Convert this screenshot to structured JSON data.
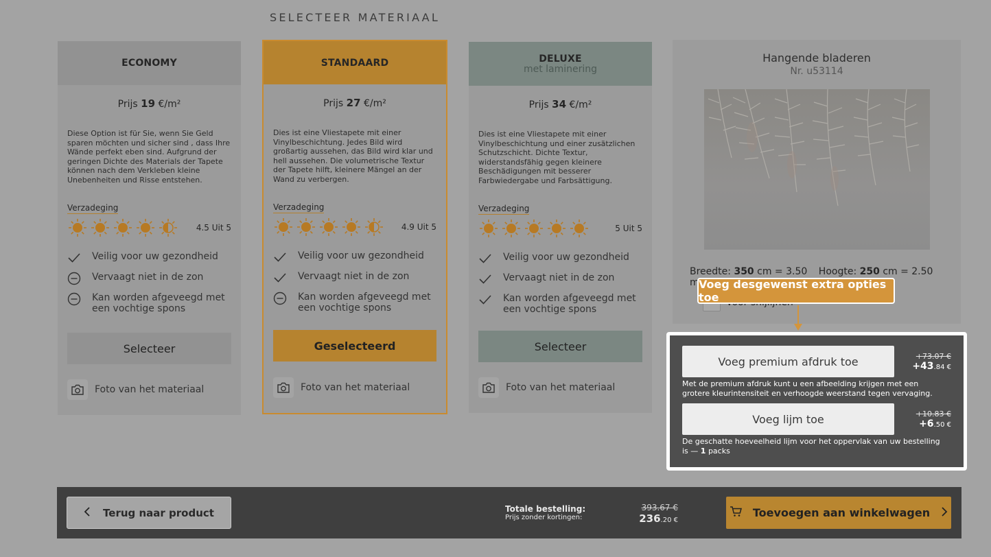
{
  "page": {
    "title": "SELECTEER MATERIAAL"
  },
  "colors": {
    "accent": "#d4953b",
    "selected_accent": "#b98630",
    "deluxe": "#7b8782"
  },
  "materials": [
    {
      "name": "ECONOMY",
      "subtitle": "",
      "price_prefix": "Prijs",
      "price_value": "19",
      "price_unit": "€/m²",
      "description": "Diese Option ist für Sie, wenn Sie Geld sparen möchten und sicher sind , dass Ihre Wände perfekt eben sind. Aufgrund der geringen Dichte des Materials der Tapete können nach dem Verkleben kleine Unebenheiten und Risse entstehen.",
      "density_label": "Verzadeging",
      "rating": 4.5,
      "rating_text": "4.5 Uit 5",
      "features": [
        {
          "icon": "check-icon",
          "text": "Veilig voor uw gezondheid"
        },
        {
          "icon": "minus-circle-icon",
          "text": "Vervaagt niet in de zon"
        },
        {
          "icon": "minus-circle-icon",
          "text": "Kan worden afgeveegd met een vochtige spons"
        }
      ],
      "button_label": "Selecteer",
      "photo_label": "Foto van het materiaal"
    },
    {
      "name": "STANDAARD",
      "subtitle": "",
      "price_prefix": "Prijs",
      "price_value": "27",
      "price_unit": "€/m²",
      "description": "Dies ist eine Vliestapete mit einer Vinylbeschichtung. Jedes Bild wird großartig aussehen, das Bild wird klar und hell aussehen. Die volumetrische Textur der Tapete hilft, kleinere Mängel an der Wand zu verbergen.",
      "density_label": "Verzadeging",
      "rating": 4.9,
      "rating_text": "4.9 Uit 5",
      "features": [
        {
          "icon": "check-icon",
          "text": "Veilig voor uw gezondheid"
        },
        {
          "icon": "check-icon",
          "text": "Vervaagt niet in de zon"
        },
        {
          "icon": "minus-circle-icon",
          "text": "Kan worden afgeveegd met een vochtige spons"
        }
      ],
      "button_label": "Geselecteerd",
      "photo_label": "Foto van het materiaal"
    },
    {
      "name": "DELUXE",
      "subtitle": "met laminering",
      "price_prefix": "Prijs",
      "price_value": "34",
      "price_unit": "€/m²",
      "description": "Dies ist eine Vliestapete mit einer Vinylbeschichtung und einer zusätzlichen Schutzschicht. Dichte Textur, widerstandsfähig gegen kleinere Beschädigungen mit besserer Farbwiedergabe und Farbsättigung.",
      "density_label": "Verzadeging",
      "rating": 5,
      "rating_text": "5 Uit 5",
      "features": [
        {
          "icon": "check-icon",
          "text": "Veilig voor uw gezondheid"
        },
        {
          "icon": "check-icon",
          "text": "Vervaagt niet in de zon"
        },
        {
          "icon": "check-icon",
          "text": "Kan worden afgeveegd met een vochtige spons"
        }
      ],
      "button_label": "Selecteer",
      "photo_label": "Foto van het materiaal"
    }
  ],
  "product": {
    "title": "Hangende bladeren",
    "code": "Nr. u53114",
    "width_label": "Breedte:",
    "width_value": "350",
    "width_unit": "cm = 3.50 m",
    "height_label": "Hoogte:",
    "height_value": "250",
    "height_unit": "cm = 2.50 m",
    "cut_label": "Voor snijlijnen"
  },
  "tooltip": {
    "text": "Voeg desgewenst extra opties toe"
  },
  "options": [
    {
      "button_label": "Voeg premium afdruk toe",
      "old_price": "+73.07 €",
      "new_price_main": "+43",
      "new_price_dec": ".84 €",
      "description": "Met de premium afdruk kunt u een afbeelding krijgen met een grotere kleurintensiteit en verhoogde weerstand tegen vervaging."
    },
    {
      "button_label": "Voeg lijm toe",
      "old_price": "+10.83 €",
      "new_price_main": "+6",
      "new_price_dec": ".50 €",
      "description_prefix": "De geschatte hoeveelheid lijm voor het oppervlak van uw bestelling is —",
      "description_qty": "1",
      "description_suffix": "packs"
    }
  ],
  "footer": {
    "back_label": "Terug naar product",
    "total_label": "Totale bestelling:",
    "total_sub": "Prijs zonder kortingen:",
    "old_total": "393.67 €",
    "new_total_main": "236",
    "new_total_dec": ".20 €",
    "cart_label": "Toevoegen aan winkelwagen"
  }
}
